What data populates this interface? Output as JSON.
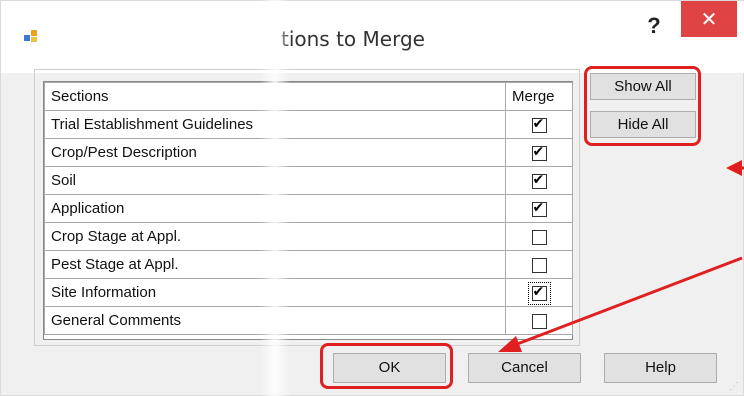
{
  "window": {
    "title": "Sections to Merge",
    "title_visible": "tions to Merge",
    "help_label": "?",
    "close_label": "✕"
  },
  "grid": {
    "columns": [
      "Sections",
      "Merge"
    ],
    "rows": [
      {
        "section": "Trial Establishment Guidelines",
        "merge": true
      },
      {
        "section": "Crop/Pest Description",
        "merge": true
      },
      {
        "section": "Soil",
        "merge": true
      },
      {
        "section": "Application",
        "merge": true
      },
      {
        "section": "Crop Stage at Appl.",
        "merge": false
      },
      {
        "section": "Pest Stage at Appl.",
        "merge": false
      },
      {
        "section": "Site Information",
        "merge": true
      },
      {
        "section": "General Comments",
        "merge": false
      }
    ]
  },
  "buttons": {
    "show_all": "Show All",
    "hide_all": "Hide All",
    "ok": "OK",
    "cancel": "Cancel",
    "help": "Help"
  },
  "colors": {
    "highlight": "#e02020",
    "close_button": "#e04343"
  }
}
